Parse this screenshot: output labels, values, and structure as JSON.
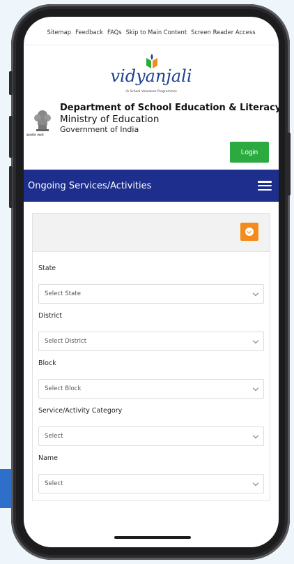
{
  "top_links": [
    "Sitemap",
    "Feedback",
    "FAQs",
    "Skip to Main Content",
    "Screen Reader Access"
  ],
  "logo": {
    "text": "vidyanjali",
    "tagline": "(A School Volunteer Programme)"
  },
  "department": {
    "title": "Department of School Education & Literacy",
    "ministry": "Ministry of Education",
    "government": "Government of India",
    "emblem_caption": "सत्यमेव जयते"
  },
  "login_label": "Login",
  "nav": {
    "title": "Ongoing Services/Activities",
    "menu_icon": "hamburger-icon"
  },
  "filter_panel": {
    "toggle_icon": "chevron-down-circle-icon",
    "fields": [
      {
        "label": "State",
        "selected": "Select State"
      },
      {
        "label": "District",
        "selected": "Select District"
      },
      {
        "label": "Block",
        "selected": "Select Block"
      },
      {
        "label": "Service/Activity Category",
        "selected": "Select"
      },
      {
        "label": "Name",
        "selected": "Select"
      }
    ]
  },
  "colors": {
    "nav_bg": "#1d2e8c",
    "login_bg": "#2bab3f",
    "toggle_bg": "#f28c1c",
    "logo_text": "#1d3f8f"
  }
}
